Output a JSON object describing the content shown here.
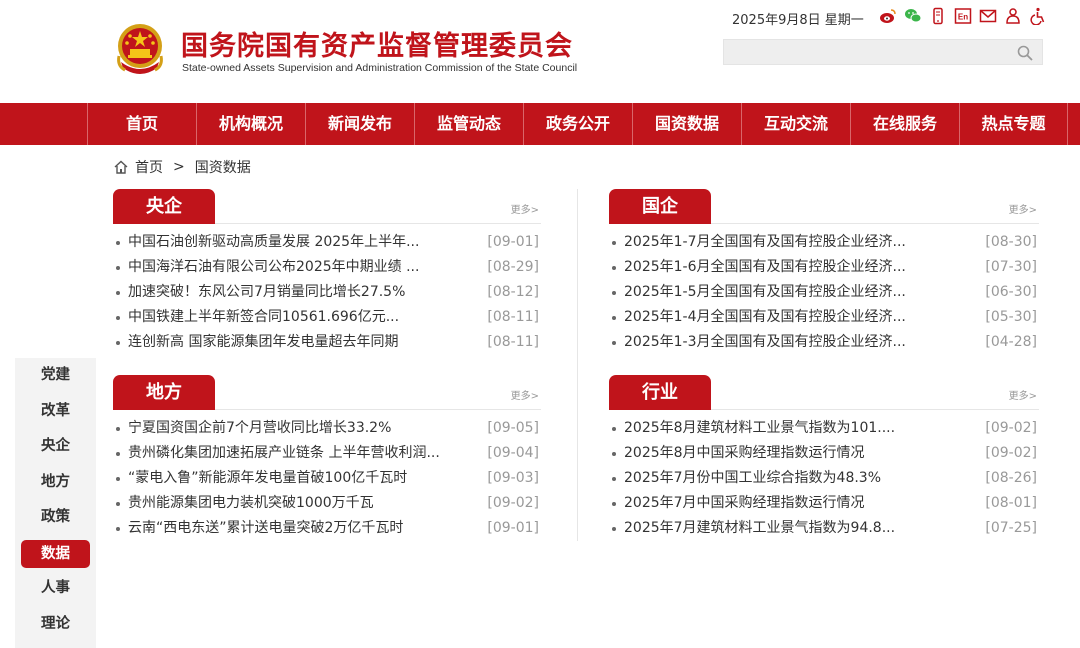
{
  "header": {
    "title": "国务院国有资产监督管理委员会",
    "subtitle": "State-owned Assets Supervision and Administration Commission of the State Council",
    "date": "2025年9月8日 星期一",
    "icons": [
      "weibo-icon",
      "wechat-icon",
      "mobile-icon",
      "english-icon",
      "mail-icon",
      "accessibility-tools-icon",
      "wheelchair-icon"
    ],
    "search_placeholder": ""
  },
  "nav": {
    "items": [
      "首页",
      "机构概况",
      "新闻发布",
      "监管动态",
      "政务公开",
      "国资数据",
      "互动交流",
      "在线服务",
      "热点专题"
    ]
  },
  "breadcrumb": {
    "home": "首页",
    "separator": ">",
    "current": "国资数据"
  },
  "sections": {
    "central": {
      "title": "央企",
      "more": "更多>",
      "items": [
        {
          "title": "中国石油创新驱动高质量发展 2025年上半年...",
          "date": "[09-01]"
        },
        {
          "title": "中国海洋石油有限公司公布2025年中期业绩 ...",
          "date": "[08-29]"
        },
        {
          "title": "加速突破！东风公司7月销量同比增长27.5%",
          "date": "[08-12]"
        },
        {
          "title": "中国铁建上半年新签合同10561.696亿元...",
          "date": "[08-11]"
        },
        {
          "title": "连创新高 国家能源集团年发电量超去年同期",
          "date": "[08-11]"
        }
      ]
    },
    "state": {
      "title": "国企",
      "more": "更多>",
      "items": [
        {
          "title": "2025年1-7月全国国有及国有控股企业经济...",
          "date": "[08-30]"
        },
        {
          "title": "2025年1-6月全国国有及国有控股企业经济...",
          "date": "[07-30]"
        },
        {
          "title": "2025年1-5月全国国有及国有控股企业经济...",
          "date": "[06-30]"
        },
        {
          "title": "2025年1-4月全国国有及国有控股企业经济...",
          "date": "[05-30]"
        },
        {
          "title": "2025年1-3月全国国有及国有控股企业经济...",
          "date": "[04-28]"
        }
      ]
    },
    "local": {
      "title": "地方",
      "more": "更多>",
      "items": [
        {
          "title": "宁夏国资国企前7个月营收同比增长33.2%",
          "date": "[09-05]"
        },
        {
          "title": "贵州磷化集团加速拓展产业链条 上半年营收利润...",
          "date": "[09-04]"
        },
        {
          "title": "“蒙电入鲁”新能源年发电量首破100亿千瓦时",
          "date": "[09-03]"
        },
        {
          "title": "贵州能源集团电力装机突破1000万千瓦",
          "date": "[09-02]"
        },
        {
          "title": "云南“西电东送”累计送电量突破2万亿千瓦时",
          "date": "[09-01]"
        }
      ]
    },
    "industry": {
      "title": "行业",
      "more": "更多>",
      "items": [
        {
          "title": "2025年8月建筑材料工业景气指数为101....",
          "date": "[09-02]"
        },
        {
          "title": "2025年8月中国采购经理指数运行情况",
          "date": "[09-02]"
        },
        {
          "title": "2025年7月份中国工业综合指数为48.3%",
          "date": "[08-26]"
        },
        {
          "title": "2025年7月中国采购经理指数运行情况",
          "date": "[08-01]"
        },
        {
          "title": "2025年7月建筑材料工业景气指数为94.8...",
          "date": "[07-25]"
        }
      ]
    }
  },
  "side_nav": {
    "items": [
      "党建",
      "改革",
      "央企",
      "地方",
      "政策",
      "数据",
      "人事",
      "理论"
    ],
    "active": "数据"
  },
  "colors": {
    "brand_red": "#c0141b",
    "muted_gray": "#999999"
  }
}
